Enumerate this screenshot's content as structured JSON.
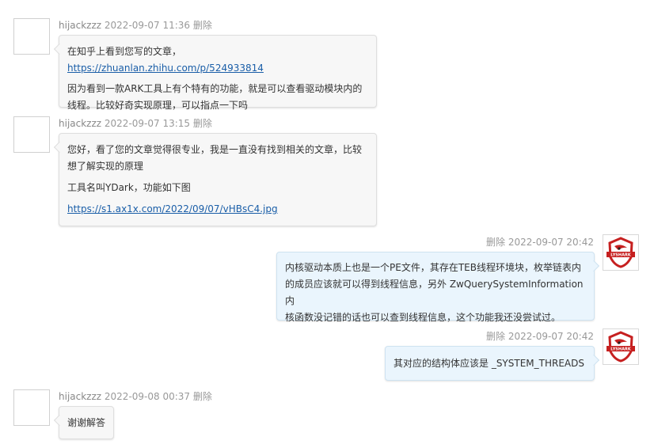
{
  "messages": [
    {
      "user": "hijackzzz",
      "time": "2022-09-07 11:36",
      "delete_label": "删除",
      "line1_text": "在知乎上看到您写的文章，",
      "line1_link": "https://zhuanlan.zhihu.com/p/524933814",
      "para2_line1": "因为看到一款ARK工具上有个特有的功能，就是可以查看驱动模块内的",
      "para2_line2": "线程。比较好奇实现原理，可以指点一下吗"
    },
    {
      "user": "hijackzzz",
      "time": "2022-09-07 13:15",
      "delete_label": "删除",
      "para1_line1": "您好，看了您的文章觉得很专业，我是一直没有找到相关的文章，比较",
      "para1_line2": "想了解实现的原理",
      "para2": "工具名叫YDark，功能如下图",
      "link": "https://s1.ax1x.com/2022/09/07/vHBsC4.jpg"
    },
    {
      "delete_label": "删除",
      "time": "2022-09-07 20:42",
      "line1": "内核驱动本质上也是一个PE文件，其存在TEB线程环境块，枚举链表内",
      "line2": "的成员应该就可以得到线程信息，另外 ZwQuerySystemInformation 内",
      "line3": "核函数没记错的话也可以查到线程信息，这个功能我还没尝试过。",
      "logo_text": "LYSHARK"
    },
    {
      "delete_label": "删除",
      "time": "2022-09-07 20:42",
      "line1": "其对应的结构体应该是 _SYSTEM_THREADS",
      "logo_text": "LYSHARK"
    },
    {
      "user": "hijackzzz",
      "time": "2022-09-08 00:37",
      "delete_label": "删除",
      "line1": "谢谢解答"
    }
  ]
}
